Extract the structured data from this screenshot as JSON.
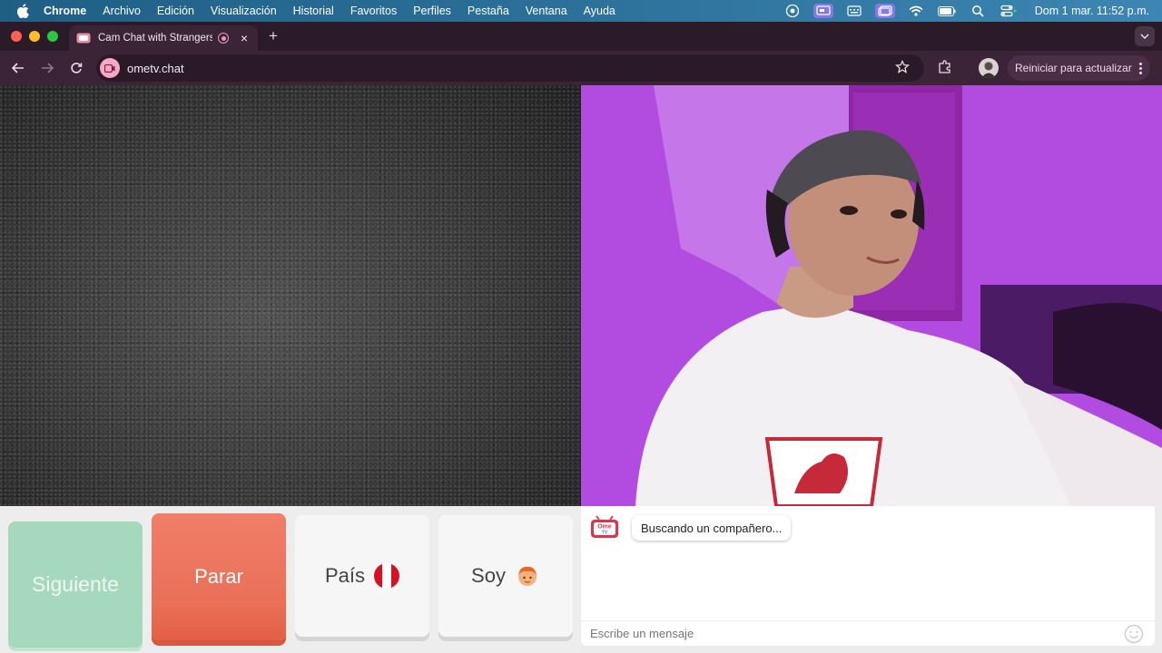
{
  "menubar": {
    "app": "Chrome",
    "items": [
      "Archivo",
      "Edición",
      "Visualización",
      "Historial",
      "Favoritos",
      "Perfiles",
      "Pestaña",
      "Ventana",
      "Ayuda"
    ],
    "clock": "Dom 1 mar.  11:52 p.m."
  },
  "browser": {
    "tab_title": "Cam Chat with Strangers",
    "url": "ometv.chat",
    "update_label": "Reiniciar para actualizar"
  },
  "controls": {
    "next_label": "Siguiente",
    "stop_label": "Parar",
    "country_label": "País",
    "gender_label": "Soy"
  },
  "chat": {
    "status_message": "Buscando un compañero...",
    "input_placeholder": "Escribe un mensaje",
    "logo_text_top": "Ome",
    "logo_text_bottom": "TV"
  },
  "colors": {
    "next": "#a6d8bd",
    "stop": "#ea7058",
    "accent_purple": "#b44ee2"
  }
}
